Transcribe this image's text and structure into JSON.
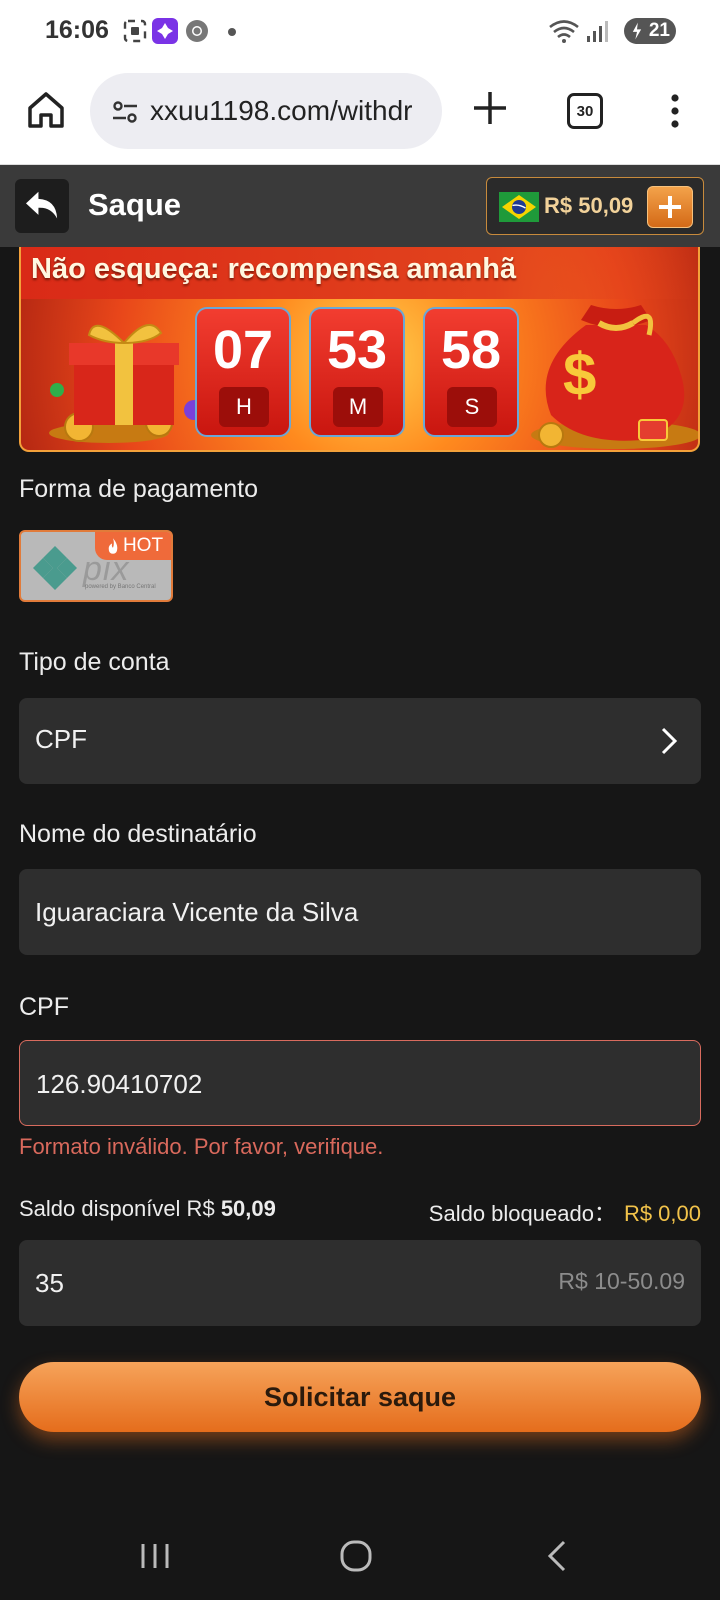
{
  "status_bar": {
    "time": "16:06",
    "battery": "21",
    "icons": [
      "screenshot-icon",
      "game-app-icon",
      "chrome-icon",
      "wifi-icon",
      "signal-icon",
      "battery-charging-icon"
    ]
  },
  "browser": {
    "url": "xxuu1198.com/withdr",
    "tab_count": "30",
    "icons": [
      "home-icon",
      "site-settings-icon",
      "new-tab-plus-icon",
      "more-vert-icon"
    ]
  },
  "header": {
    "title": "Saque",
    "balance": "R$ 50,09",
    "icons": [
      "back-arrow-icon",
      "brazil-flag-icon",
      "plus-icon"
    ]
  },
  "banner": {
    "headline": "Não esqueça: recompensa amanhã",
    "timer": [
      {
        "value": "07",
        "unit": "H"
      },
      {
        "value": "53",
        "unit": "M"
      },
      {
        "value": "58",
        "unit": "S"
      }
    ]
  },
  "form": {
    "payment_label": "Forma de pagamento",
    "payment_method": {
      "name": "pix",
      "sub": "powered by Banco Central",
      "badge": "HOT"
    },
    "account_type_label": "Tipo de conta",
    "account_type_value": "CPF",
    "recipient_label": "Nome do destinatário",
    "recipient_value": "Iguaraciara Vicente da Silva",
    "cpf_label": "CPF",
    "cpf_value": "126.90410702",
    "cpf_error": "Formato inválido. Por favor, verifique.",
    "available_label": "Saldo disponível R$",
    "available_value": "50,09",
    "locked_label": "Saldo bloqueado：",
    "locked_value": "R$ 0,00",
    "amount_value": "35",
    "amount_range": "R$ 10-50.09",
    "submit_label": "Solicitar saque"
  },
  "colors": {
    "accent_orange": "#e56d1c",
    "error_red": "#d9695c",
    "locked_yellow": "#f2c34a",
    "background": "#161616",
    "field": "#2e2e2e"
  }
}
